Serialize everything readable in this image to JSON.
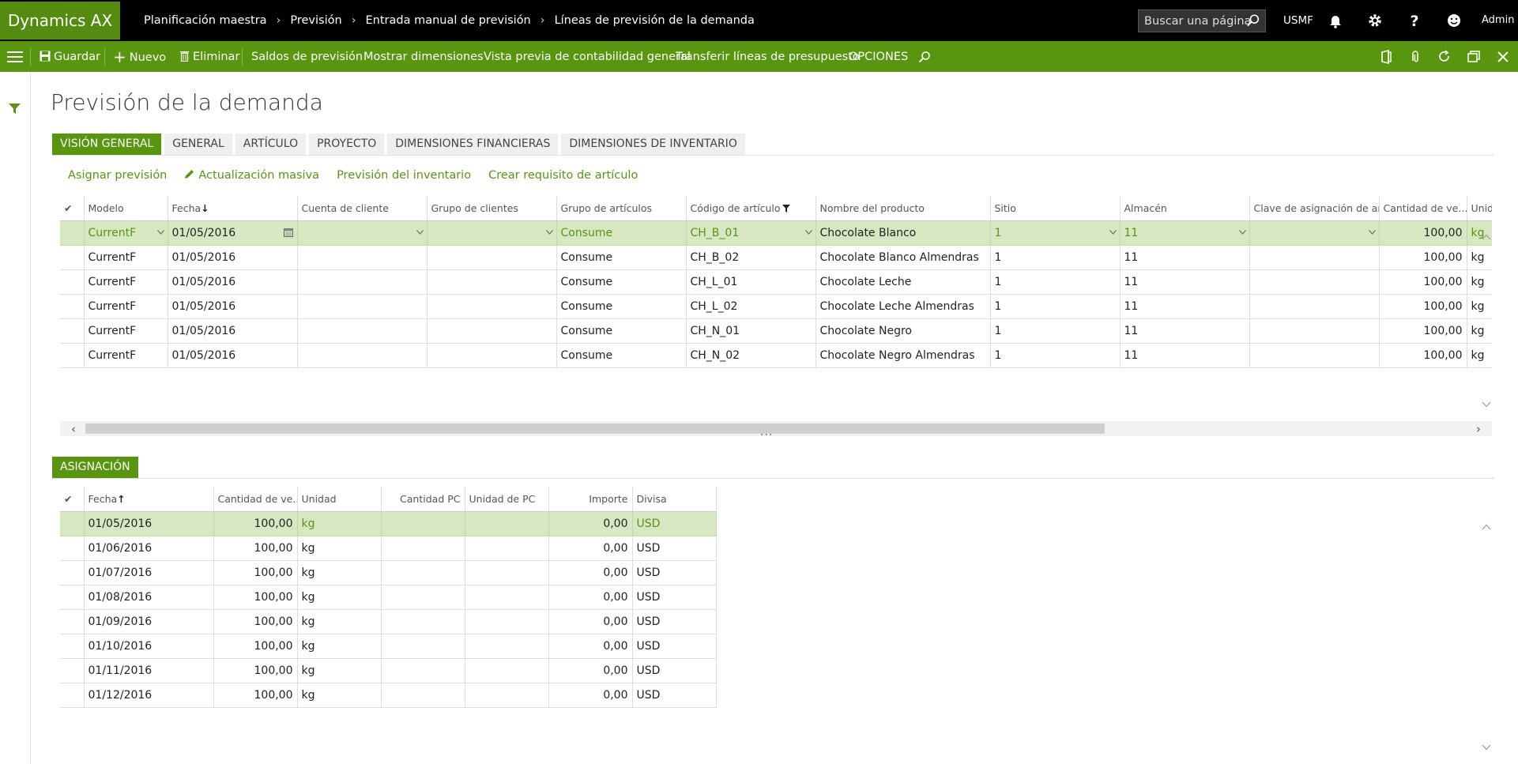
{
  "app": {
    "brand": "Dynamics AX"
  },
  "breadcrumb": [
    "Planificación maestra",
    "Previsión",
    "Entrada manual de previsión",
    "Líneas de previsión de la demanda"
  ],
  "search": {
    "placeholder": "Buscar una página"
  },
  "company": "USMF",
  "user": "Admin",
  "actions": {
    "save": "Guardar",
    "new": "Nuevo",
    "delete": "Eliminar",
    "forecast_balances": "Saldos de previsión",
    "show_dimensions": "Mostrar dimensiones",
    "ledger_preview": "Vista previa de contabilidad general",
    "transfer_budget": "Transferir líneas de presupuesto",
    "options": "OPCIONES"
  },
  "page_title": "Previsión de la demanda",
  "tabs": [
    "VISIÓN GENERAL",
    "GENERAL",
    "ARTÍCULO",
    "PROYECTO",
    "DIMENSIONES FINANCIERAS",
    "DIMENSIONES DE INVENTARIO"
  ],
  "sub_actions": {
    "assign": "Asignar previsión",
    "mass_update": "Actualización masiva",
    "inventory_forecast": "Previsión del inventario",
    "create_requirement": "Crear requisito de artículo"
  },
  "lines": {
    "headers": [
      "Modelo",
      "Fecha",
      "Cuenta de cliente",
      "Grupo de clientes",
      "Grupo de artículos",
      "Código de artículo",
      "Nombre del producto",
      "Sitio",
      "Almacén",
      "Clave de asignación de artí...",
      "Cantidad de ve...",
      "Unidad"
    ],
    "rows": [
      {
        "model": "CurrentF",
        "date": "01/05/2016",
        "customer": "",
        "customer_group": "",
        "item_group": "Consume",
        "item_code": "CH_B_01",
        "product": "Chocolate Blanco",
        "site": "1",
        "warehouse": "11",
        "alloc_key": "",
        "qty": "100,00",
        "unit": "kg"
      },
      {
        "model": "CurrentF",
        "date": "01/05/2016",
        "customer": "",
        "customer_group": "",
        "item_group": "Consume",
        "item_code": "CH_B_02",
        "product": "Chocolate Blanco Almendras",
        "site": "1",
        "warehouse": "11",
        "alloc_key": "",
        "qty": "100,00",
        "unit": "kg"
      },
      {
        "model": "CurrentF",
        "date": "01/05/2016",
        "customer": "",
        "customer_group": "",
        "item_group": "Consume",
        "item_code": "CH_L_01",
        "product": "Chocolate Leche",
        "site": "1",
        "warehouse": "11",
        "alloc_key": "",
        "qty": "100,00",
        "unit": "kg"
      },
      {
        "model": "CurrentF",
        "date": "01/05/2016",
        "customer": "",
        "customer_group": "",
        "item_group": "Consume",
        "item_code": "CH_L_02",
        "product": "Chocolate Leche Almendras",
        "site": "1",
        "warehouse": "11",
        "alloc_key": "",
        "qty": "100,00",
        "unit": "kg"
      },
      {
        "model": "CurrentF",
        "date": "01/05/2016",
        "customer": "",
        "customer_group": "",
        "item_group": "Consume",
        "item_code": "CH_N_01",
        "product": "Chocolate Negro",
        "site": "1",
        "warehouse": "11",
        "alloc_key": "",
        "qty": "100,00",
        "unit": "kg"
      },
      {
        "model": "CurrentF",
        "date": "01/05/2016",
        "customer": "",
        "customer_group": "",
        "item_group": "Consume",
        "item_code": "CH_N_02",
        "product": "Chocolate Negro Almendras",
        "site": "1",
        "warehouse": "11",
        "alloc_key": "",
        "qty": "100,00",
        "unit": "kg"
      }
    ]
  },
  "allocation": {
    "tab": "ASIGNACIÓN",
    "headers": [
      "Fecha",
      "Cantidad de ve...",
      "Unidad",
      "Cantidad PC",
      "Unidad de PC",
      "Importe",
      "Divisa"
    ],
    "rows": [
      {
        "date": "01/05/2016",
        "qty": "100,00",
        "unit": "kg",
        "qty_pc": "",
        "unit_pc": "",
        "amount": "0,00",
        "currency": "USD"
      },
      {
        "date": "01/06/2016",
        "qty": "100,00",
        "unit": "kg",
        "qty_pc": "",
        "unit_pc": "",
        "amount": "0,00",
        "currency": "USD"
      },
      {
        "date": "01/07/2016",
        "qty": "100,00",
        "unit": "kg",
        "qty_pc": "",
        "unit_pc": "",
        "amount": "0,00",
        "currency": "USD"
      },
      {
        "date": "01/08/2016",
        "qty": "100,00",
        "unit": "kg",
        "qty_pc": "",
        "unit_pc": "",
        "amount": "0,00",
        "currency": "USD"
      },
      {
        "date": "01/09/2016",
        "qty": "100,00",
        "unit": "kg",
        "qty_pc": "",
        "unit_pc": "",
        "amount": "0,00",
        "currency": "USD"
      },
      {
        "date": "01/10/2016",
        "qty": "100,00",
        "unit": "kg",
        "qty_pc": "",
        "unit_pc": "",
        "amount": "0,00",
        "currency": "USD"
      },
      {
        "date": "01/11/2016",
        "qty": "100,00",
        "unit": "kg",
        "qty_pc": "",
        "unit_pc": "",
        "amount": "0,00",
        "currency": "USD"
      },
      {
        "date": "01/12/2016",
        "qty": "100,00",
        "unit": "kg",
        "qty_pc": "",
        "unit_pc": "",
        "amount": "0,00",
        "currency": "USD"
      }
    ]
  },
  "colors": {
    "accent": "#57960e",
    "selected_row": "#d6e7c2",
    "topbar": "#000000"
  }
}
